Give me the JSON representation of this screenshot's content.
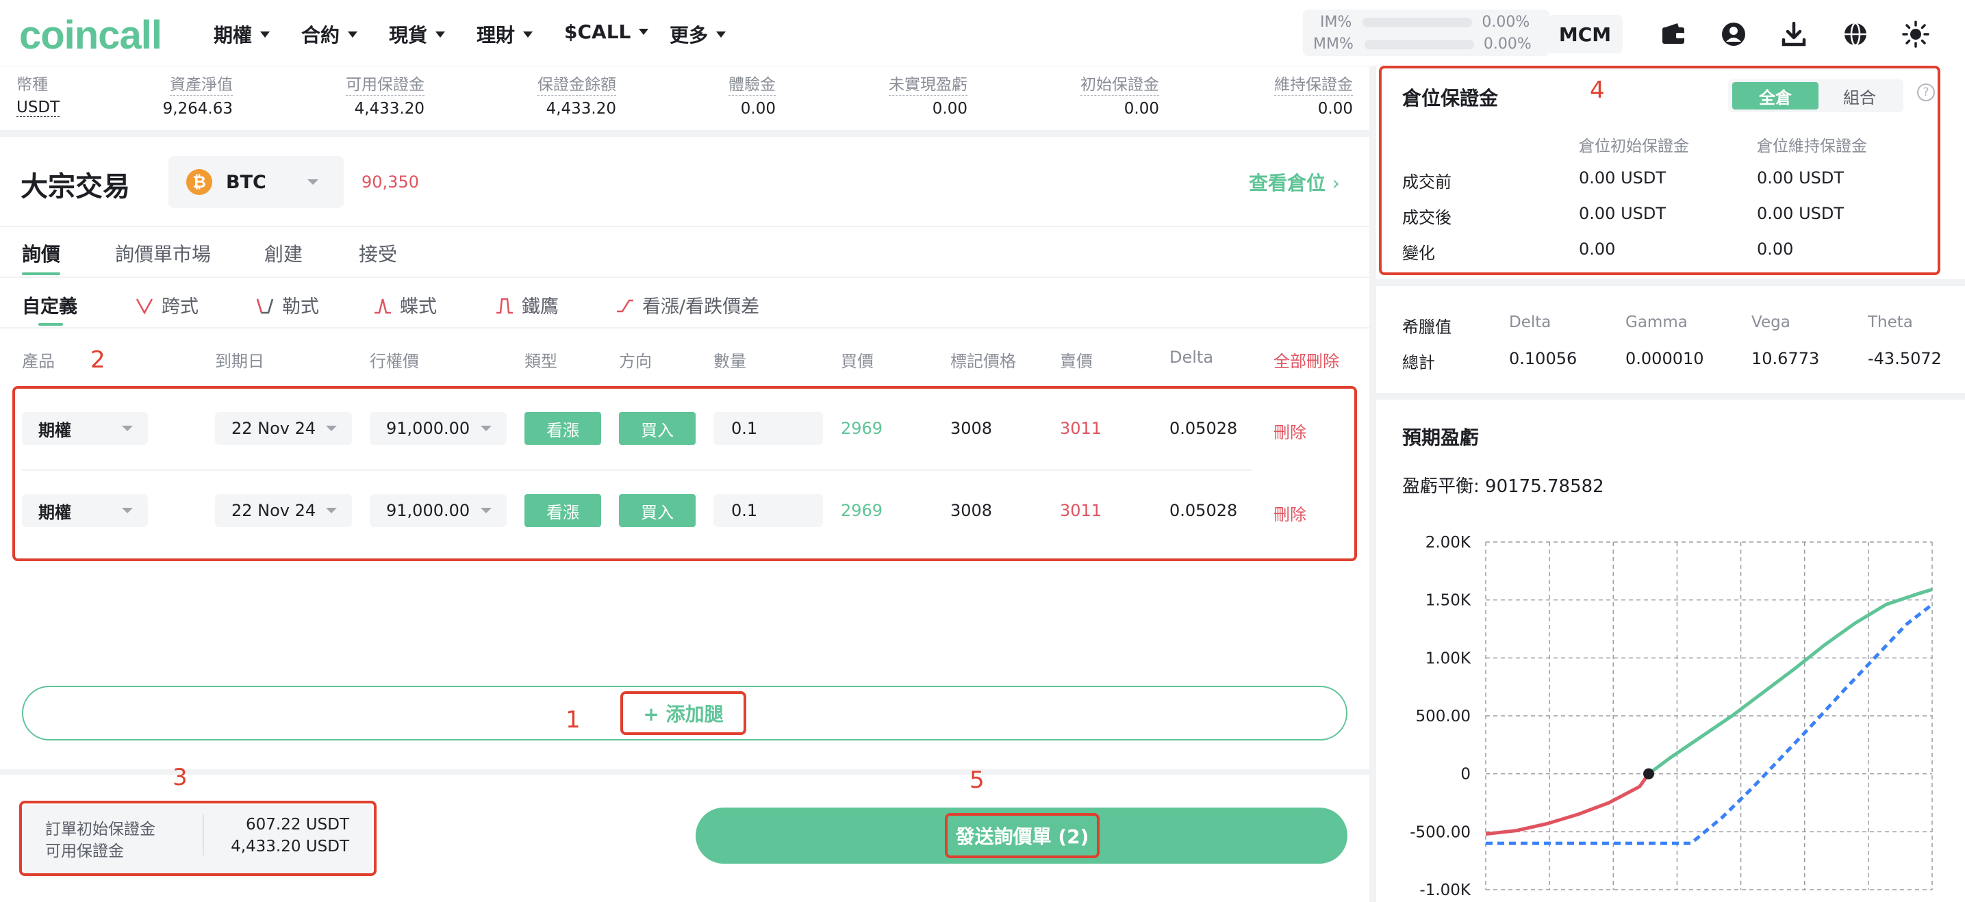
{
  "header": {
    "logo": "coincall",
    "nav": [
      {
        "label": "期權"
      },
      {
        "label": "合約"
      },
      {
        "label": "現貨"
      },
      {
        "label": "理財"
      },
      {
        "label": "$CALL"
      },
      {
        "label": "更多"
      }
    ],
    "im_label": "IM%",
    "im_value": "0.00%",
    "mm_label": "MM%",
    "mm_value": "0.00%",
    "account_tag": "MCM"
  },
  "summary": {
    "currency_label": "幣種",
    "currency_value": "USDT",
    "items": [
      {
        "label": "資產淨值",
        "value": "9,264.63"
      },
      {
        "label": "可用保證金",
        "value": "4,433.20"
      },
      {
        "label": "保證金餘額",
        "value": "4,433.20"
      },
      {
        "label": "體驗金",
        "value": "0.00"
      },
      {
        "label": "未實現盈虧",
        "value": "0.00"
      },
      {
        "label": "初始保證金",
        "value": "0.00"
      },
      {
        "label": "維持保證金",
        "value": "0.00"
      }
    ]
  },
  "main": {
    "title": "大宗交易",
    "asset": {
      "icon_letter": "₿",
      "label": "BTC"
    },
    "index_price": "90,350",
    "view_positions": "查看倉位",
    "tabs": [
      "詢價",
      "詢價單市場",
      "創建",
      "接受"
    ],
    "strategies": [
      "自定義",
      "跨式",
      "勒式",
      "蝶式",
      "鐵鷹",
      "看漲/看跌價差"
    ],
    "columns": [
      "產品",
      "到期日",
      "行權價",
      "類型",
      "方向",
      "數量",
      "買價",
      "標記價格",
      "賣價",
      "Delta"
    ],
    "delete_all": "全部刪除",
    "legs": [
      {
        "product": "期權",
        "expiry": "22 Nov 24",
        "strike": "91,000.00",
        "type": "看漲",
        "side": "買入",
        "qty": "0.1",
        "bid": "2969",
        "mark": "3008",
        "ask": "3011",
        "delta": "0.05028",
        "delete": "刪除"
      },
      {
        "product": "期權",
        "expiry": "22 Nov 24",
        "strike": "91,000.00",
        "type": "看漲",
        "side": "買入",
        "qty": "0.1",
        "bid": "2969",
        "mark": "3008",
        "ask": "3011",
        "delta": "0.05028",
        "delete": "刪除"
      }
    ],
    "add_leg": "+ 添加腿",
    "order_margin_label": "訂單初始保證金",
    "order_margin_value": "607.22 USDT",
    "avail_margin_label": "可用保證金",
    "avail_margin_value": "4,433.20 USDT",
    "send_rfq": "發送詢價單 (2)"
  },
  "annotations": [
    "1",
    "2",
    "3",
    "4",
    "5"
  ],
  "position_margin": {
    "title": "倉位保證金",
    "toggle_on": "全倉",
    "toggle_off": "組合",
    "help": "?",
    "col_initial": "倉位初始保證金",
    "col_maint": "倉位維持保證金",
    "rows": [
      {
        "label": "成交前",
        "initial": "0.00 USDT",
        "maint": "0.00 USDT"
      },
      {
        "label": "成交後",
        "initial": "0.00 USDT",
        "maint": "0.00 USDT"
      },
      {
        "label": "變化",
        "initial": "0.00",
        "maint": "0.00"
      }
    ]
  },
  "greeks": {
    "header": "希臘值",
    "cols": [
      "Delta",
      "Gamma",
      "Vega",
      "Theta"
    ],
    "row_label": "總計",
    "values": [
      "0.10056",
      "0.000010",
      "10.6773",
      "-43.5072"
    ]
  },
  "pnl": {
    "title": "預期盈虧",
    "breakeven": "盈虧平衡: 90175.78582"
  },
  "colors": {
    "accent": "#5fc497",
    "red": "#e0535f",
    "annotation": "#e0402f",
    "dashed": "#3b82f6"
  },
  "chart_data": {
    "type": "line",
    "title": "",
    "xlabel": "",
    "ylabel": "",
    "ylim": [
      -1000,
      2000
    ],
    "y_ticks": [
      "2.00K",
      "1.50K",
      "1.00K",
      "500.00",
      "0",
      "-500.00",
      "-1.00K"
    ],
    "x_range": [
      87000,
      95700
    ],
    "grid": true,
    "series": [
      {
        "style": "solid-red-green",
        "x": [
          87000,
          87600,
          88200,
          88800,
          89400,
          90000,
          90176,
          90600,
          91200,
          91800,
          92400,
          93000,
          93600,
          94200,
          94800,
          95400,
          95700
        ],
        "values": [
          -520,
          -490,
          -430,
          -350,
          -250,
          -110,
          0,
          140,
          320,
          500,
          700,
          900,
          1110,
          1300,
          1460,
          1550,
          1590
        ]
      },
      {
        "style": "dashed-blue",
        "x": [
          87000,
          91000,
          91600,
          92200,
          92800,
          93400,
          94000,
          94600,
          95200,
          95700
        ],
        "values": [
          -600,
          -600,
          -380,
          -120,
          160,
          440,
          730,
          1010,
          1290,
          1460
        ]
      }
    ],
    "marker": {
      "x": 90176,
      "y": 0
    }
  }
}
